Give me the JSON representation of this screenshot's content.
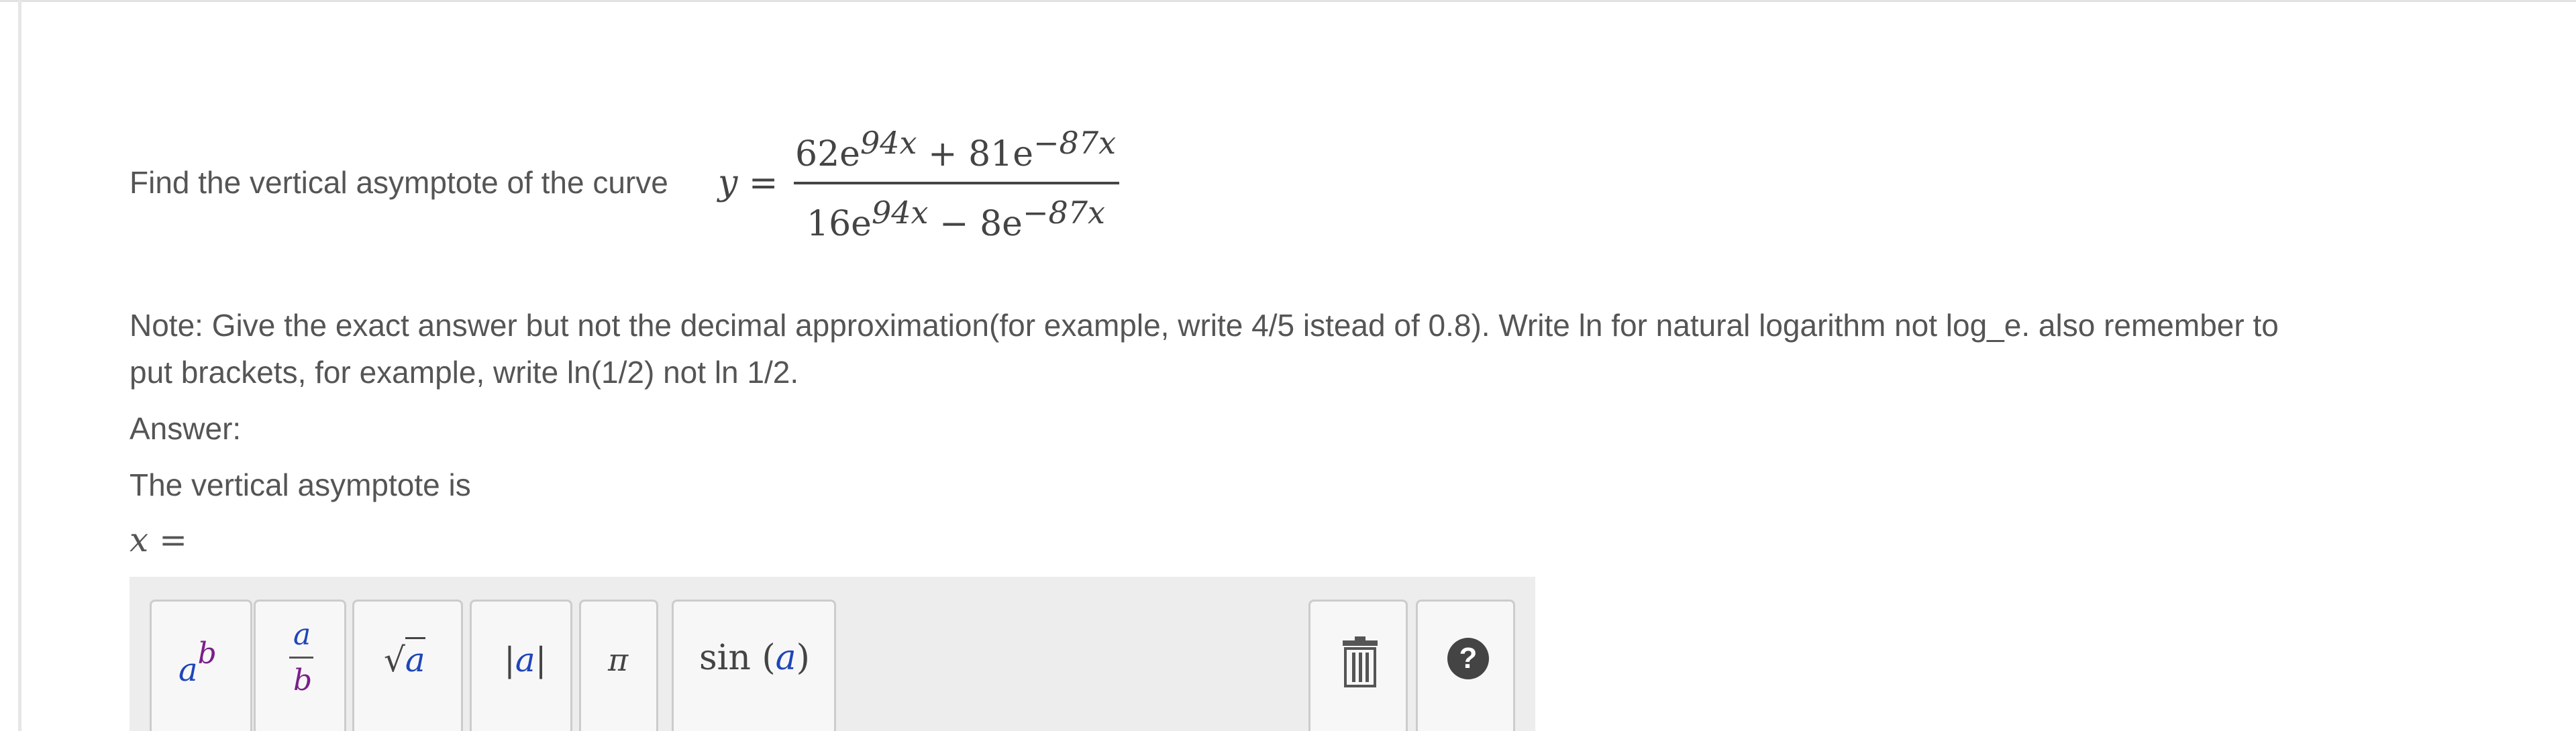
{
  "question": {
    "prompt": "Find the vertical asymptote of the curve",
    "y_lhs": "y =",
    "numerator": {
      "coef1": "62e",
      "exp1": "94x",
      "op": "+ 81e",
      "exp2": "−87x"
    },
    "denominator": {
      "coef1": "16e",
      "exp1": "94x",
      "op": "− 8e",
      "exp2": "−87x"
    }
  },
  "note": {
    "line1": "Note: Give the exact answer but not the decimal approximation(for example, write 4/5 istead of 0.8). Write ln for natural logarithm not log_e. also remember to",
    "line2": "put brackets, for example, write ln(1/2) not ln 1/2."
  },
  "answer_label": "Answer:",
  "asymptote_label": "The vertical asymptote is",
  "answer_lhs": "x =",
  "palette": {
    "power": {
      "base": "a",
      "exp": "b"
    },
    "fraction": {
      "num": "a",
      "den": "b"
    },
    "sqrt": {
      "symbol": "√",
      "arg": "a"
    },
    "abs": {
      "left": "|",
      "arg": "a",
      "right": "|"
    },
    "pi": "π",
    "sin": {
      "fn": "sin",
      "open": "(",
      "arg": "a",
      "close": ")"
    },
    "help_symbol": "?"
  }
}
